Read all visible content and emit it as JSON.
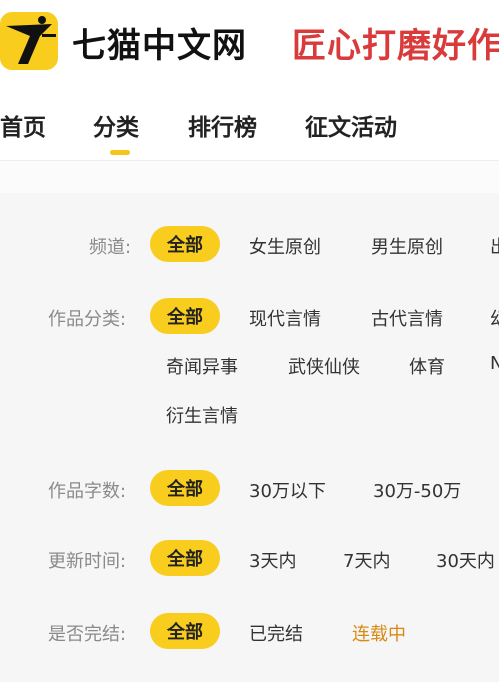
{
  "header": {
    "logo_name": "seven-cats-logo",
    "brand": "七猫中文网",
    "slogan": "匠心打磨好作"
  },
  "nav": {
    "tabs": [
      "首页",
      "分类",
      "排行榜",
      "征文活动"
    ],
    "active_index": 1
  },
  "filters": {
    "channel": {
      "label": "频道:",
      "selected": "全部",
      "options": [
        "女生原创",
        "男生原创",
        "出"
      ]
    },
    "category": {
      "label": "作品分类:",
      "selected": "全部",
      "options_row1": [
        "现代言情",
        "古代言情",
        "幻"
      ],
      "options_row2": [
        "奇闻异事",
        "武侠仙侠",
        "体育",
        "N"
      ],
      "options_row3": [
        "衍生言情"
      ]
    },
    "word_count": {
      "label": "作品字数:",
      "selected": "全部",
      "options": [
        "30万以下",
        "30万-50万"
      ]
    },
    "update_time": {
      "label": "更新时间:",
      "selected": "全部",
      "options": [
        "3天内",
        "7天内",
        "30天内"
      ]
    },
    "status": {
      "label": "是否完结:",
      "selected": "全部",
      "options": [
        "已完结",
        "连载中"
      ]
    }
  },
  "colors": {
    "accent": "#f8cd1e",
    "slogan_red": "#d93a3a",
    "highlight_orange": "#d98a14"
  }
}
